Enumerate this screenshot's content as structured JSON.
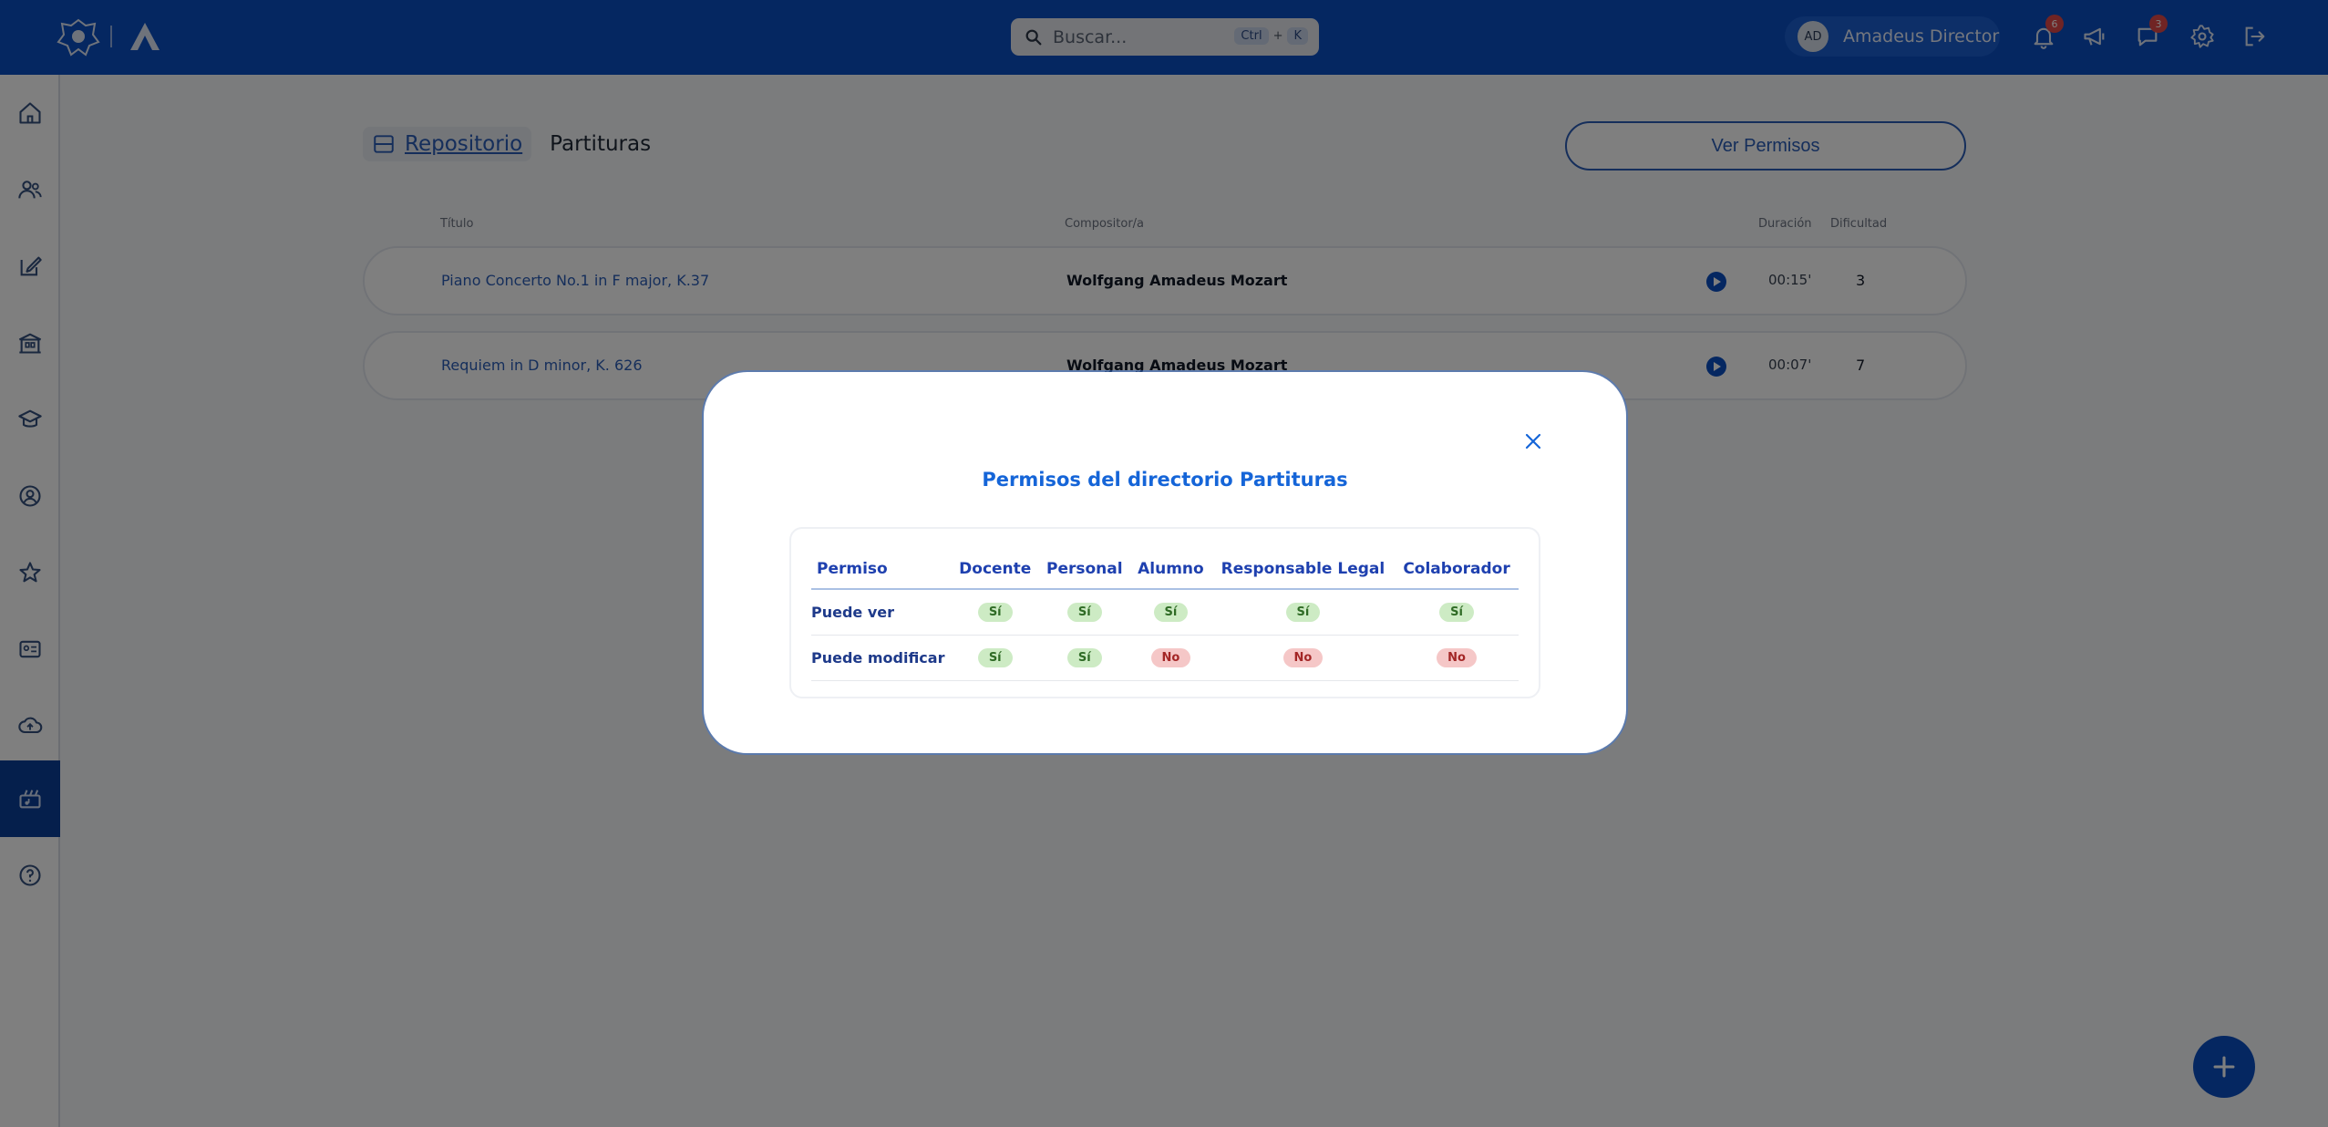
{
  "header": {
    "search_placeholder": "Buscar...",
    "shortcut_ctrl": "Ctrl",
    "shortcut_plus": "+",
    "shortcut_k": "K",
    "user_initials": "AD",
    "user_name": "Amadeus Director",
    "notifications_count": "6",
    "messages_count": "3"
  },
  "sidebar": {
    "items": [
      "home-icon",
      "users-icon",
      "edit-icon",
      "building-icon",
      "graduation-cap-icon",
      "user-circle-icon",
      "star-icon",
      "id-card-icon",
      "cloud-upload-icon",
      "scores-icon",
      "help-icon"
    ],
    "active_index": 9
  },
  "breadcrumb": {
    "root": "Repositorio",
    "current": "Partituras"
  },
  "actions": {
    "ver_permisos": "Ver Permisos"
  },
  "table": {
    "columns": {
      "titulo": "Título",
      "compositor": "Compositor/a",
      "duracion": "Duración",
      "dificultad": "Dificultad"
    },
    "rows": [
      {
        "titulo": "Piano Concerto No.1 in F major, K.37",
        "compositor": "Wolfgang Amadeus Mozart",
        "duracion": "00:15'",
        "dificultad": "3"
      },
      {
        "titulo": "Requiem in D minor, K. 626",
        "compositor": "Wolfgang Amadeus Mozart",
        "duracion": "00:07'",
        "dificultad": "7"
      }
    ]
  },
  "modal": {
    "title": "Permisos del directorio Partituras",
    "headers": [
      "Permiso",
      "Docente",
      "Personal",
      "Alumno",
      "Responsable Legal",
      "Colaborador"
    ],
    "rows": [
      {
        "label": "Puede ver",
        "values": [
          "Sí",
          "Sí",
          "Sí",
          "Sí",
          "Sí"
        ]
      },
      {
        "label": "Puede modificar",
        "values": [
          "Sí",
          "Sí",
          "No",
          "No",
          "No"
        ]
      }
    ]
  },
  "colors": {
    "brand": "#0b4fc3",
    "sidebar_active": "#0b3f98",
    "yes_bg": "#cdebc4",
    "no_bg": "#f5c7c7"
  }
}
